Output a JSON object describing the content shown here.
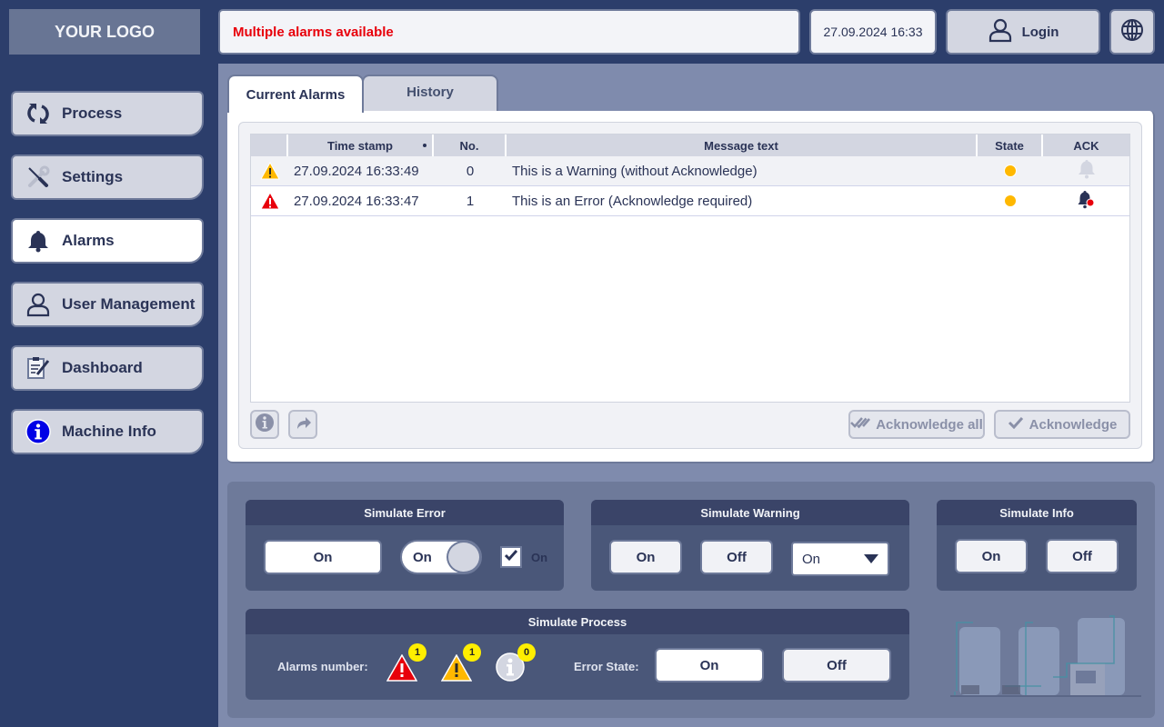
{
  "header": {
    "logo": "YOUR LOGO",
    "message": "Multiple alarms available",
    "datetime": "27.09.2024 16:33",
    "login_label": "Login",
    "language_icon": "globe-icon"
  },
  "sidebar": {
    "items": [
      {
        "label": "Process",
        "icon": "refresh-icon",
        "active": false
      },
      {
        "label": "Settings",
        "icon": "tools-icon",
        "active": false
      },
      {
        "label": "Alarms",
        "icon": "bell-icon",
        "active": true
      },
      {
        "label": "User Management",
        "icon": "user-icon",
        "active": false
      },
      {
        "label": "Dashboard",
        "icon": "clipboard-edit-icon",
        "active": false
      },
      {
        "label": "Machine Info",
        "icon": "info-icon",
        "active": false
      }
    ]
  },
  "tabs": [
    {
      "label": "Current Alarms",
      "active": true
    },
    {
      "label": "History",
      "active": false
    }
  ],
  "alarm_table": {
    "columns": [
      "",
      "Time stamp",
      "No.",
      "Message text",
      "State",
      "ACK"
    ],
    "rows": [
      {
        "type": "warning",
        "timestamp": "27.09.2024 16:33:49",
        "no": "0",
        "message": "This is a Warning (without Acknowledge)",
        "state_color": "#ffb800",
        "ack": "not-required"
      },
      {
        "type": "error",
        "timestamp": "27.09.2024 16:33:47",
        "no": "1",
        "message": "This is an Error (Acknowledge required)",
        "state_color": "#ffb800",
        "ack": "required"
      }
    ]
  },
  "alarm_actions": {
    "info_icon": "info-icon",
    "forward_icon": "share-arrow-icon",
    "ack_all_label": "Acknowledge all",
    "ack_label": "Acknowledge"
  },
  "simulate_error": {
    "title": "Simulate Error",
    "button_label": "On",
    "toggle_label": "On",
    "toggle_on": true,
    "checkbox_checked": true,
    "checkbox_label": "On"
  },
  "simulate_warning": {
    "title": "Simulate Warning",
    "on_label": "On",
    "off_label": "Off",
    "select_value": "On"
  },
  "simulate_info": {
    "title": "Simulate Info",
    "on_label": "On",
    "off_label": "Off"
  },
  "simulate_process": {
    "title": "Simulate Process",
    "alarms_label": "Alarms number:",
    "error_count": "1",
    "warning_count": "1",
    "info_count": "0",
    "error_state_label": "Error State:",
    "on_label": "On",
    "off_label": "Off"
  },
  "colors": {
    "error": "#e8000b",
    "warning": "#ffb800",
    "badge": "#ffee00",
    "nav_bg": "#2c3e6b"
  }
}
